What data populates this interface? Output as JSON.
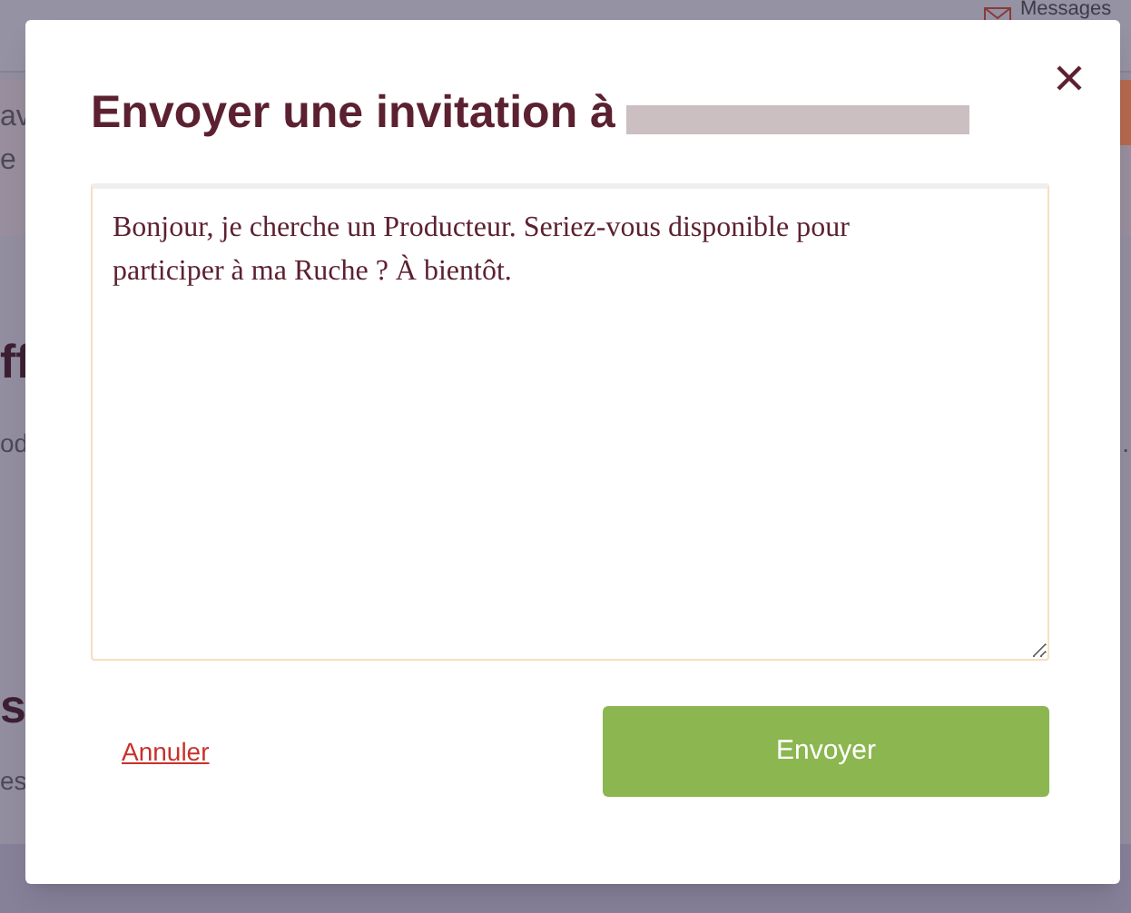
{
  "background": {
    "messages_link": "Messages",
    "fragments": [
      {
        "text": "av",
        "kind": "left"
      },
      {
        "text": "e",
        "kind": "left"
      },
      {
        "text": "ff",
        "kind": "heading"
      },
      {
        "text": "od",
        "kind": "left"
      },
      {
        "text": ".",
        "kind": "right"
      },
      {
        "text": "s",
        "kind": "heading"
      },
      {
        "text": "es",
        "kind": "left"
      }
    ]
  },
  "dialog": {
    "title": "Envoyer une invitation à",
    "message": "Bonjour, je cherche un Producteur. Seriez-vous disponible pour participer à ma Ruche ? À bientôt.",
    "cancel": "Annuler",
    "submit": "Envoyer"
  }
}
